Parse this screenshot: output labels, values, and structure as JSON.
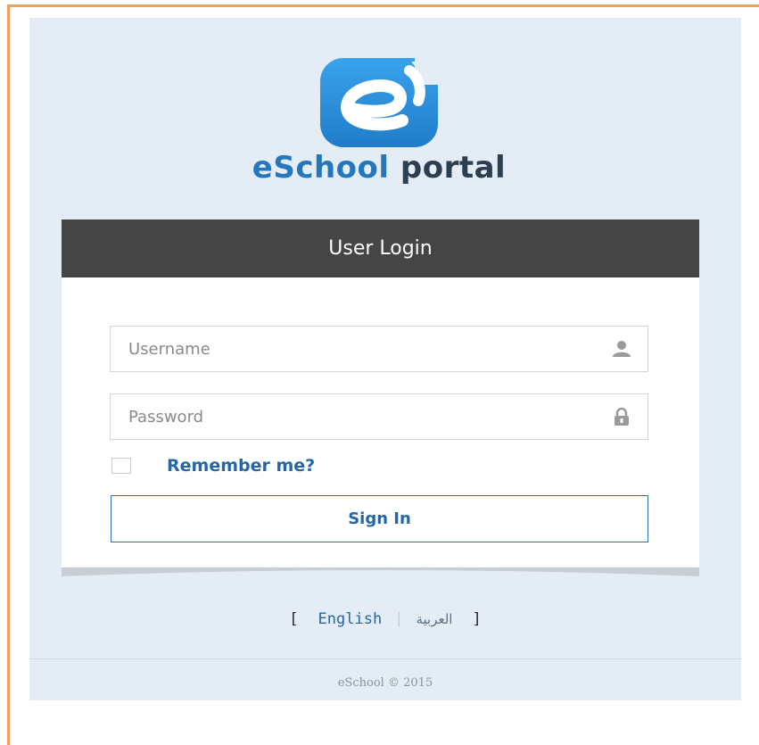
{
  "brand": {
    "part1": "eSchool",
    "part2": "portal",
    "logo_icon": "eschool-logo-icon",
    "primary_color": "#2a86d6",
    "dark_color": "#2c3e50"
  },
  "login": {
    "header": "User Login",
    "username_placeholder": "Username",
    "password_placeholder": "Password",
    "username_icon": "user-icon",
    "password_icon": "lock-icon",
    "remember_label": "Remember me?",
    "signin_label": "Sign In"
  },
  "language": {
    "open_bracket": "[",
    "english": "English",
    "separator": "|",
    "arabic": "العربية",
    "close_bracket": "]"
  },
  "footer": {
    "copyright": "eSchool © 2015"
  }
}
